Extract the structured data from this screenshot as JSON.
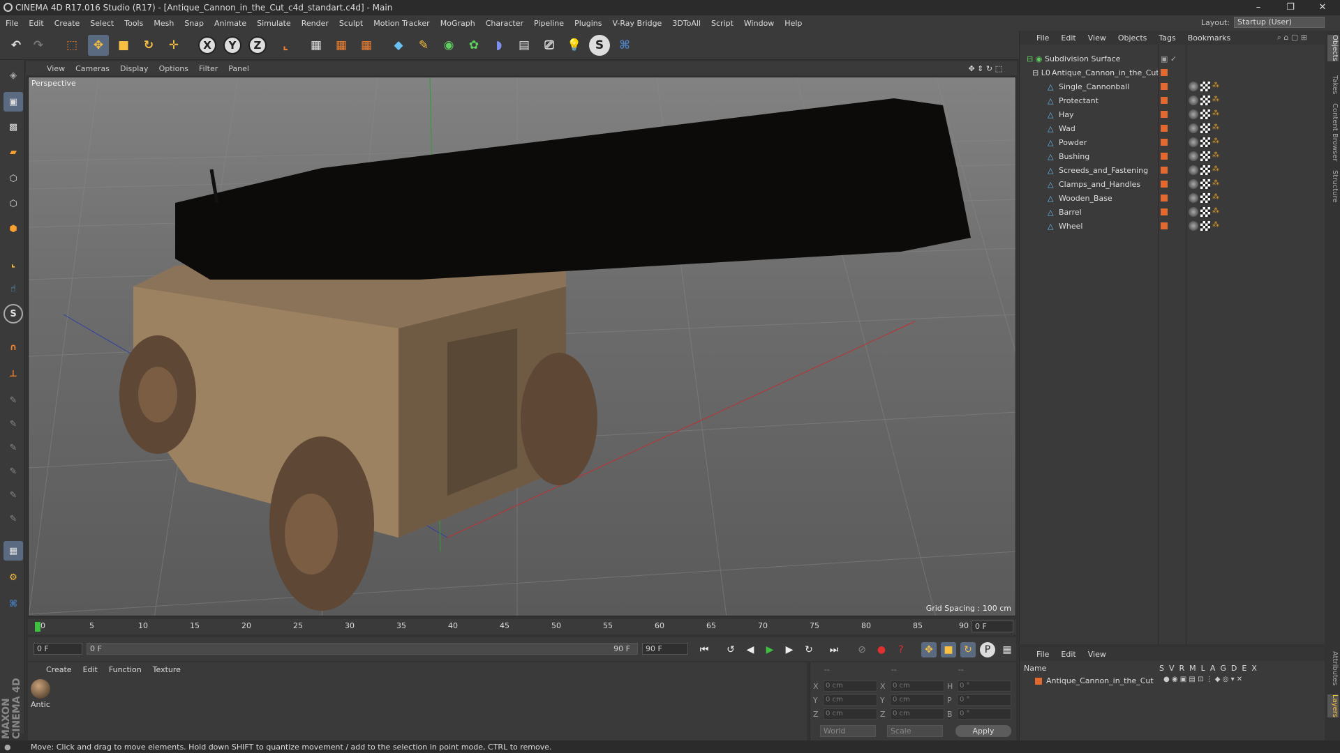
{
  "window": {
    "title": "CINEMA 4D R17.016 Studio (R17) - [Antique_Cannon_in_the_Cut_c4d_standart.c4d] - Main",
    "minimize": "–",
    "maximize": "❐",
    "close": "✕"
  },
  "menu": [
    "File",
    "Edit",
    "Create",
    "Select",
    "Tools",
    "Mesh",
    "Snap",
    "Animate",
    "Simulate",
    "Render",
    "Sculpt",
    "Motion Tracker",
    "MoGraph",
    "Character",
    "Pipeline",
    "Plugins",
    "V-Ray Bridge",
    "3DToAll",
    "Script",
    "Window",
    "Help"
  ],
  "layout": {
    "label": "Layout:",
    "value": "Startup (User)"
  },
  "viewport": {
    "menu": [
      "View",
      "Cameras",
      "Display",
      "Options",
      "Filter",
      "Panel"
    ],
    "label": "Perspective",
    "grid_spacing": "Grid Spacing : 100 cm"
  },
  "timeline": {
    "ticks": [
      "0",
      "5",
      "10",
      "15",
      "20",
      "25",
      "30",
      "35",
      "40",
      "45",
      "50",
      "55",
      "60",
      "65",
      "70",
      "75",
      "80",
      "85",
      "90"
    ],
    "frame_end_field": "0 F"
  },
  "transport": {
    "start": "0 F",
    "range_start": "0 F",
    "range_end": "90 F",
    "end": "90 F"
  },
  "material": {
    "menu": [
      "Create",
      "Edit",
      "Function",
      "Texture"
    ],
    "item_label": "Antic"
  },
  "coords": {
    "x": "0 cm",
    "y": "0 cm",
    "z": "0 cm",
    "sx": "0 cm",
    "sy": "0 cm",
    "sz": "0 cm",
    "h": "0 °",
    "p": "0 °",
    "b": "0 °",
    "world": "World",
    "scale": "Scale",
    "apply": "Apply",
    "dash1": "--",
    "dash2": "--",
    "dash3": "--"
  },
  "objects": {
    "menu": [
      "File",
      "Edit",
      "View",
      "Objects",
      "Tags",
      "Bookmarks"
    ],
    "root": "Subdivision Surface",
    "group": "Antique_Cannon_in_the_Cut",
    "children": [
      "Single_Cannonball",
      "Protectant",
      "Hay",
      "Wad",
      "Powder",
      "Bushing",
      "Screeds_and_Fastening",
      "Clamps_and_Handles",
      "Wooden_Base",
      "Barrel",
      "Wheel"
    ]
  },
  "layers": {
    "menu": [
      "File",
      "Edit",
      "View"
    ],
    "name_header": "Name",
    "cols": [
      "S",
      "V",
      "R",
      "M",
      "L",
      "A",
      "G",
      "D",
      "E",
      "X"
    ],
    "row": "Antique_Cannon_in_the_Cut"
  },
  "right_tabs": [
    "Objects",
    "Takes",
    "Content Browser",
    "Structure",
    "Attributes",
    "Layers"
  ],
  "status": "Move: Click and drag to move elements. Hold down SHIFT to quantize movement / add to the selection in point mode, CTRL to remove.",
  "brand": "MAXON CINEMA 4D"
}
